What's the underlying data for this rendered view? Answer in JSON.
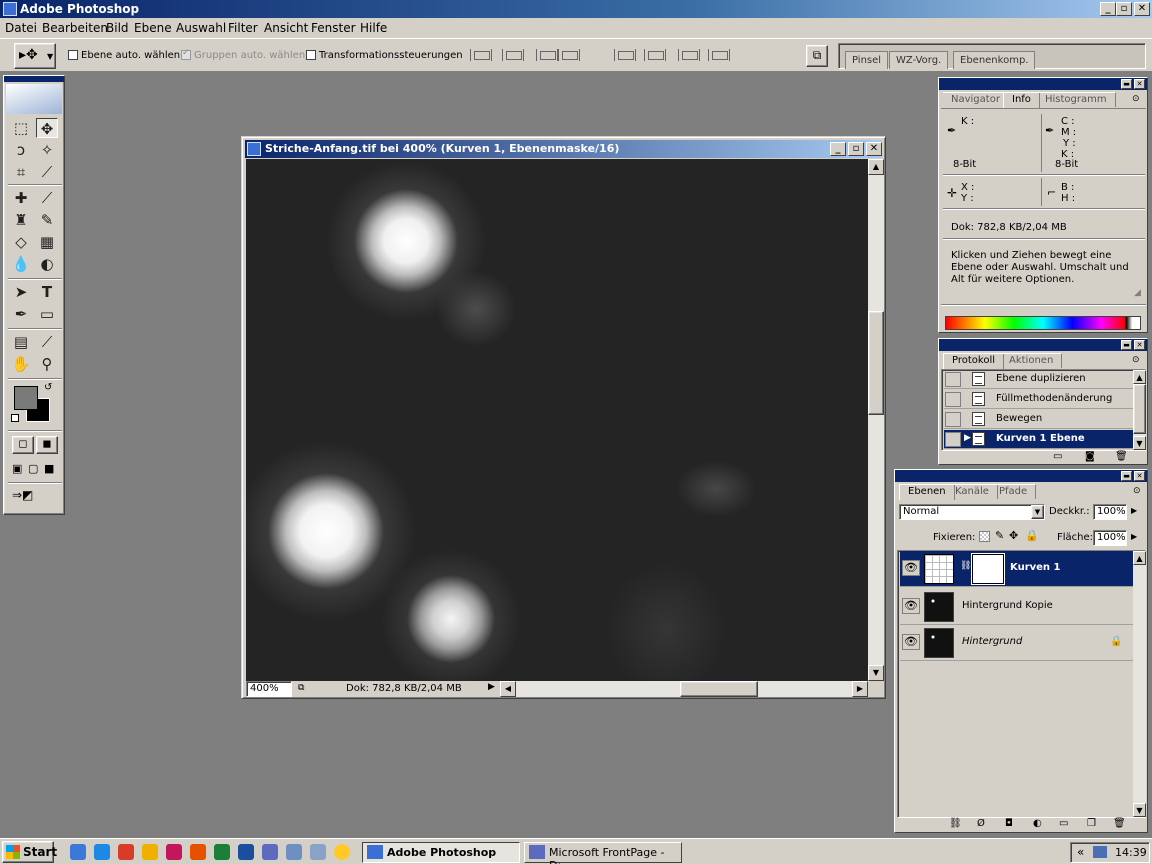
{
  "app": {
    "title": "Adobe Photoshop"
  },
  "menu": [
    "Datei",
    "Bearbeiten",
    "Bild",
    "Ebene",
    "Auswahl",
    "Filter",
    "Ansicht",
    "Fenster",
    "Hilfe"
  ],
  "options": {
    "auto_layer": "Ebene auto. wählen",
    "auto_group": "Gruppen auto. wählen",
    "transform_controls": "Transformationssteuerungen",
    "palette_well_tabs": [
      "Pinsel",
      "WZ-Vorg.",
      "Ebenenkomp."
    ]
  },
  "document": {
    "title": "Striche-Anfang.tif bei 400% (Kurven 1, Ebenenmaske/16)",
    "zoom": "400%",
    "status": "Dok: 782,8 KB/2,04 MB"
  },
  "info_palette": {
    "tabs": [
      "Navigator",
      "Info",
      "Histogramm"
    ],
    "k_label": "K :",
    "c_label": "C :",
    "m_label": "M :",
    "y_label": "Y :",
    "k2_label": "K :",
    "bit_left": "8-Bit",
    "bit_right": "8-Bit",
    "x_label": "X :",
    "y2_label": "Y :",
    "b_label": "B :",
    "h_label": "H :",
    "doc_size": "Dok: 782,8 KB/2,04 MB",
    "hint": "Klicken und Ziehen bewegt eine Ebene oder Auswahl. Umschalt und Alt für weitere Optionen."
  },
  "history_palette": {
    "tabs": [
      "Protokoll",
      "Aktionen"
    ],
    "items": [
      {
        "label": "Ebene duplizieren"
      },
      {
        "label": "Füllmethodenänderung"
      },
      {
        "label": "Bewegen"
      },
      {
        "label": "Kurven 1 Ebene"
      }
    ]
  },
  "layers_palette": {
    "tabs": [
      "Ebenen",
      "Kanäle",
      "Pfade"
    ],
    "blend_mode": "Normal",
    "opacity_label": "Deckkr.:",
    "opacity": "100%",
    "lock_label": "Fixieren:",
    "fill_label": "Fläche:",
    "fill": "100%",
    "layers": [
      {
        "name": "Kurven 1"
      },
      {
        "name": "Hintergrund Kopie"
      },
      {
        "name": "Hintergrund"
      }
    ]
  },
  "taskbar": {
    "start": "Start",
    "tasks": [
      "Adobe Photoshop",
      "Microsoft FrontPage - D:..."
    ],
    "tray_arrow": "«",
    "clock": "14:39"
  }
}
